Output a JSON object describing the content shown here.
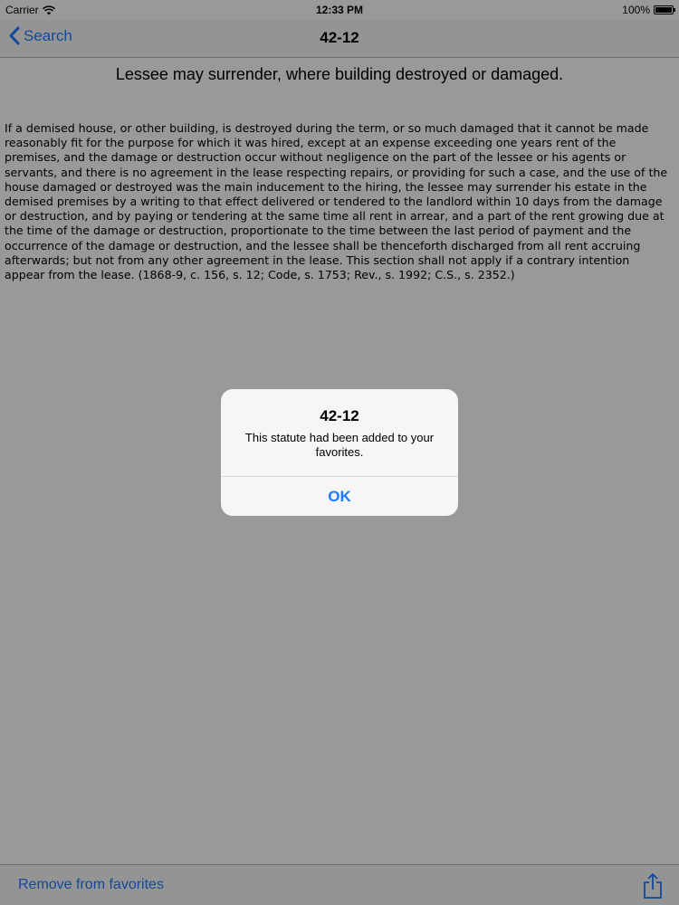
{
  "status_bar": {
    "carrier": "Carrier",
    "time": "12:33 PM",
    "battery": "100%",
    "battery_level": 1.0
  },
  "nav": {
    "back_label": "Search",
    "title": "42-12"
  },
  "content": {
    "heading": "Lessee may surrender, where building destroyed or damaged.",
    "body": "If a demised house, or other building, is destroyed during the term, or so much damaged that it cannot be made reasonably fit for the purpose for which it was hired, except at an expense exceeding one years rent of the premises, and the damage or destruction occur without negligence on the part of the lessee or his agents or servants, and there is no agreement in the lease respecting repairs, or providing for such a case, and the use of the house damaged or destroyed was the main inducement to the hiring, the lessee may surrender his estate in the demised premises by a writing to that effect delivered or tendered to the landlord within 10 days from the damage or destruction, and by paying or tendering at the same time all rent in arrear, and a part of the rent growing due at the time of the damage or destruction, proportionate to the time between the last period of payment and the occurrence of the damage or destruction, and the lessee shall be thenceforth discharged from all rent accruing afterwards; but not from any other agreement in the lease. This section shall not apply if a contrary intention appear from the lease. (1868-9, c. 156, s. 12; Code, s. 1753; Rev., s. 1992; C.S., s. 2352.)"
  },
  "toolbar": {
    "remove_label": "Remove from favorites"
  },
  "alert": {
    "title": "42-12",
    "message": "This statute had been added to your favorites.",
    "ok_label": "OK"
  },
  "colors": {
    "accent": "#1e7bff",
    "overlay": "rgba(0,0,0,0.4)"
  },
  "icons": {
    "back": "chevron-left-icon",
    "share": "share-icon",
    "wifi": "wifi-icon",
    "battery": "battery-icon"
  }
}
